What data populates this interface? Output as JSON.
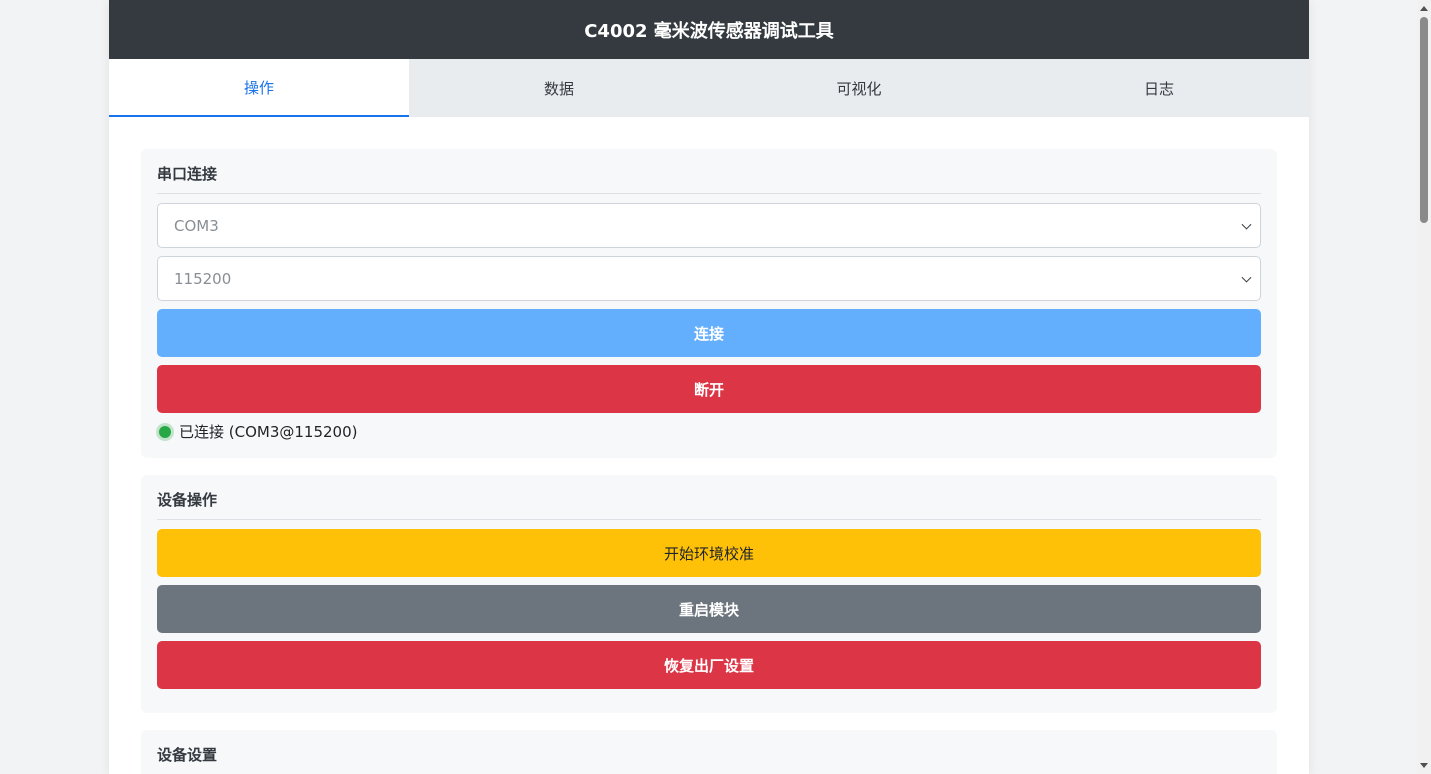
{
  "app": {
    "title": "C4002 毫米波传感器调试工具"
  },
  "tabs": [
    {
      "label": "操作",
      "active": true
    },
    {
      "label": "数据",
      "active": false
    },
    {
      "label": "可视化",
      "active": false
    },
    {
      "label": "日志",
      "active": false
    }
  ],
  "serial": {
    "title": "串口连接",
    "port_value": "COM3",
    "baud_value": "115200",
    "connect_label": "连接",
    "disconnect_label": "断开",
    "status_text": "已连接 (COM3@115200)",
    "status_color": "#28a745"
  },
  "device_ops": {
    "title": "设备操作",
    "calibrate_label": "开始环境校准",
    "restart_label": "重启模块",
    "factory_reset_label": "恢复出厂设置"
  },
  "device_settings": {
    "title": "设备设置"
  },
  "colors": {
    "titlebar": "#343a40",
    "accent": "#1a73e8",
    "primary": "#63aefd",
    "danger": "#dc3545",
    "warning": "#ffc107",
    "secondary": "#6c757d"
  }
}
